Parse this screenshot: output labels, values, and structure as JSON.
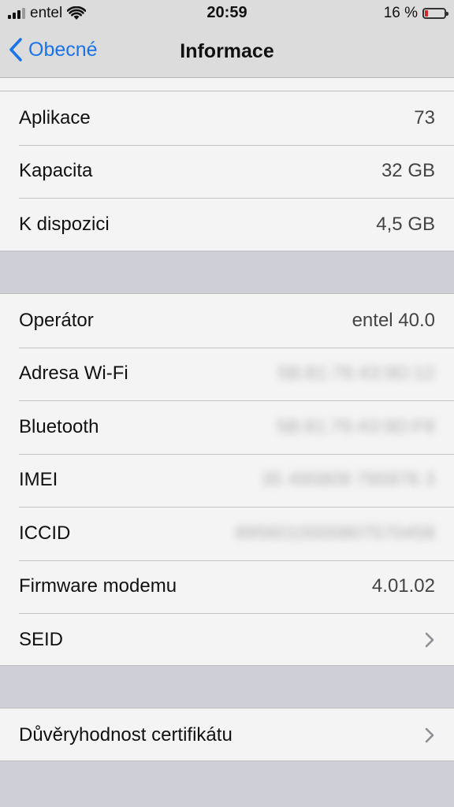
{
  "status_bar": {
    "carrier": "entel",
    "time": "20:59",
    "battery_percent": "16 %",
    "battery_level": 0.16,
    "icons": [
      "signal-icon",
      "wifi-icon",
      "battery-icon"
    ]
  },
  "nav": {
    "back_label": "Obecné",
    "title": "Informace"
  },
  "group1": {
    "rows": [
      {
        "label": "Aplikace",
        "value": "73"
      },
      {
        "label": "Kapacita",
        "value": "32 GB"
      },
      {
        "label": "K dispozici",
        "value": "4,5 GB"
      }
    ]
  },
  "group2": {
    "rows": [
      {
        "label": "Operátor",
        "value": "entel 40.0"
      },
      {
        "label": "Adresa Wi-Fi",
        "value": "5B:81:76:43:9D:12"
      },
      {
        "label": "Bluetooth",
        "value": "5B:81:76:43:9D:F8"
      },
      {
        "label": "IMEI",
        "value": "35 495809 795976 3"
      },
      {
        "label": "ICCID",
        "value": "8956010000807570458"
      },
      {
        "label": "Firmware modemu",
        "value": "4.01.02"
      },
      {
        "label": "SEID",
        "value": ""
      }
    ]
  },
  "group3": {
    "rows": [
      {
        "label": "Důvěryhodnost certifikátu",
        "value": ""
      }
    ]
  },
  "colors": {
    "accent": "#1a73e8",
    "battery_low": "#d0272c",
    "group_bg": "#f4f4f4",
    "page_bg": "#cfcfd7"
  }
}
